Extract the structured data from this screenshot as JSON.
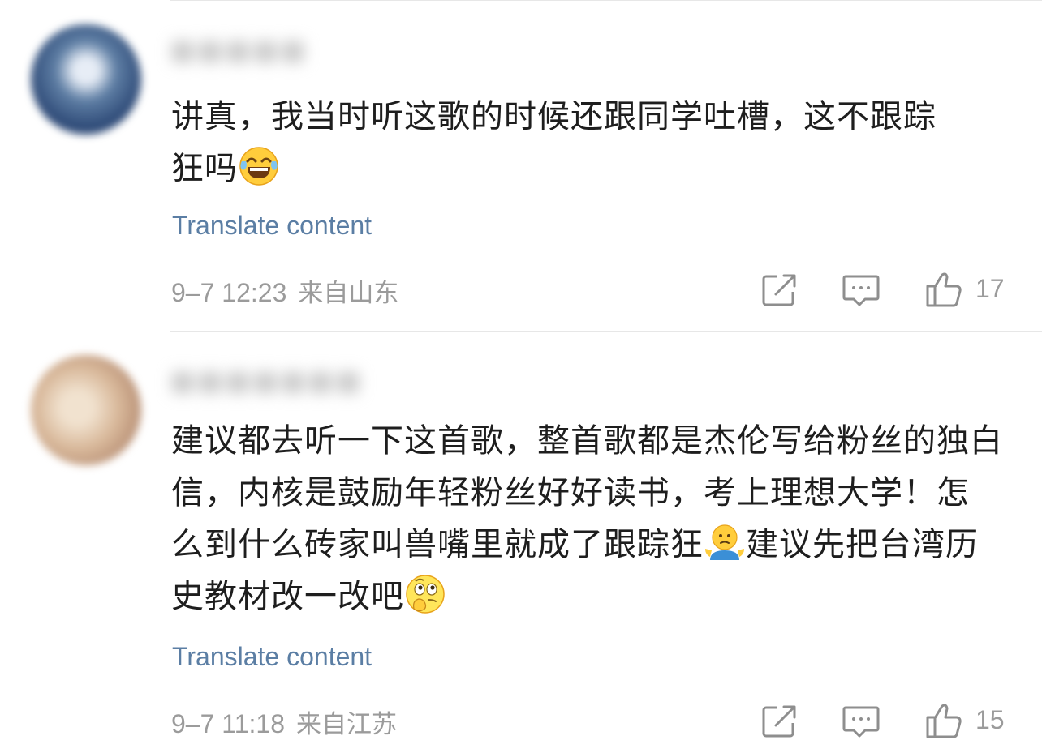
{
  "comments": [
    {
      "text_lines": [
        "讲真，我当时听这歌的时候还跟同学吐槽，这不跟踪",
        "狂吗"
      ],
      "translate_label": "Translate content",
      "time": "9–7 12:23",
      "location": "来自山东",
      "likes": "17",
      "emojis": [
        "laughing-crying-emoji"
      ]
    },
    {
      "text_lines": [
        "建议都去听一下这首歌，整首歌都是杰伦写给粉丝的独白",
        "信，内核是鼓励年轻粉丝好好读书，考上理想大学！怎",
        "么到什么砖家叫兽嘴里就成了跟踪狂",
        "建议先把台湾历",
        "史教材改一改吧"
      ],
      "translate_label": "Translate content",
      "time": "9–7 11:18",
      "location": "来自江苏",
      "likes": "15",
      "emojis": [
        "shrug-emoji",
        "thinking-emoji"
      ]
    }
  ],
  "icons": {
    "share": "share-icon",
    "reply": "comment-icon",
    "like": "thumbs-up-icon"
  },
  "colors": {
    "link": "#5b7ea4",
    "meta": "#9b9b9b",
    "text": "#1e1e1e",
    "divider": "#e7e7e7"
  }
}
